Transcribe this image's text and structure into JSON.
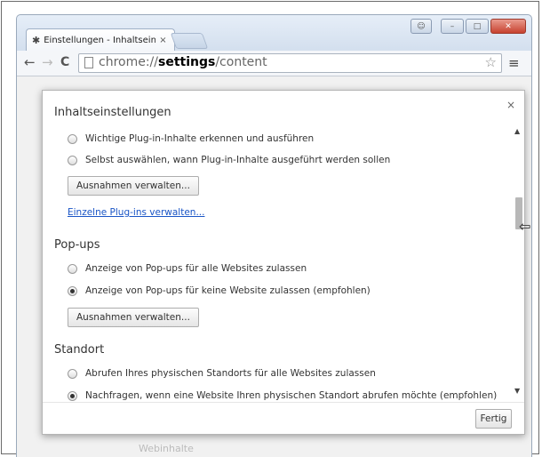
{
  "browser": {
    "tab_title": "Einstellungen - Inhaltsein",
    "tab_icon": "gear-icon",
    "url_prefix": "chrome://",
    "url_bold": "settings",
    "url_suffix": "/content",
    "window_user_glyph": "☺",
    "window_minimize_glyph": "–",
    "window_maximize_glyph": "□",
    "window_close_glyph": "✕",
    "back_glyph": "←",
    "forward_glyph": "→",
    "reload_glyph": "C",
    "star_glyph": "☆",
    "menu_glyph": "≡",
    "tab_close_glyph": "×",
    "tab_icon_glyph": "✱",
    "background_hint": "Webinhalte"
  },
  "dialog": {
    "title": "Inhaltseinstellungen",
    "close_glyph": "×",
    "plugins": {
      "options": [
        {
          "label": "Wichtige Plug-in-Inhalte erkennen und ausführen",
          "checked": false
        },
        {
          "label": "Selbst auswählen, wann Plug-in-Inhalte ausgeführt werden sollen",
          "checked": false
        }
      ],
      "exceptions_button": "Ausnahmen verwalten...",
      "manage_link": "Einzelne Plug-ins verwalten..."
    },
    "popups": {
      "heading": "Pop-ups",
      "options": [
        {
          "label": "Anzeige von Pop-ups für alle Websites zulassen",
          "checked": false
        },
        {
          "label": "Anzeige von Pop-ups für keine Website zulassen (empfohlen)",
          "checked": true
        }
      ],
      "exceptions_button": "Ausnahmen verwalten..."
    },
    "location": {
      "heading": "Standort",
      "options": [
        {
          "label": "Abrufen Ihres physischen Standorts für alle Websites zulassen",
          "checked": false
        },
        {
          "label": "Nachfragen, wenn eine Website Ihren physischen Standort abrufen möchte (empfohlen)",
          "checked": true
        }
      ]
    },
    "scroll_up_glyph": "▲",
    "scroll_down_glyph": "▼",
    "done_button": "Fertig"
  }
}
